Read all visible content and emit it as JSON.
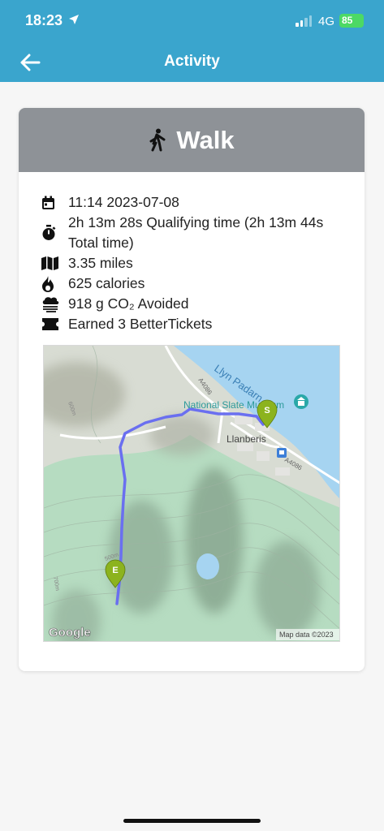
{
  "status_bar": {
    "time": "18:23",
    "network": "4G",
    "battery": "85"
  },
  "app_bar": {
    "title": "Activity"
  },
  "activity": {
    "type": "Walk",
    "details": [
      {
        "icon": "calendar-icon",
        "text": "11:14 2023-07-08"
      },
      {
        "icon": "stopwatch-icon",
        "text": "2h 13m 28s Qualifying time (2h 13m 44s Total time)"
      },
      {
        "icon": "map-icon",
        "text": "3.35 miles"
      },
      {
        "icon": "flame-icon",
        "text": "625 calories"
      },
      {
        "icon": "co2-cloud-icon",
        "text": "918 g CO₂ Avoided"
      },
      {
        "icon": "ticket-icon",
        "text": "Earned 3 BetterTickets"
      }
    ]
  },
  "map": {
    "lake_name": "Llyn Padarn",
    "road_label_1": "A4086",
    "road_label_2": "A4086",
    "museum_label": "National Slate Museum",
    "town_label": "Llanberis",
    "start_marker": "S",
    "end_marker": "E",
    "contour_label_1": "600m",
    "contour_label_2": "500m",
    "contour_label_3": "700m",
    "google_logo": "Google",
    "attribution": "Map data ©2023",
    "colors": {
      "route": "#6a6ff0",
      "marker": "#8cb31e",
      "water": "#a6d4f1",
      "park": "#b6dcc1"
    }
  }
}
